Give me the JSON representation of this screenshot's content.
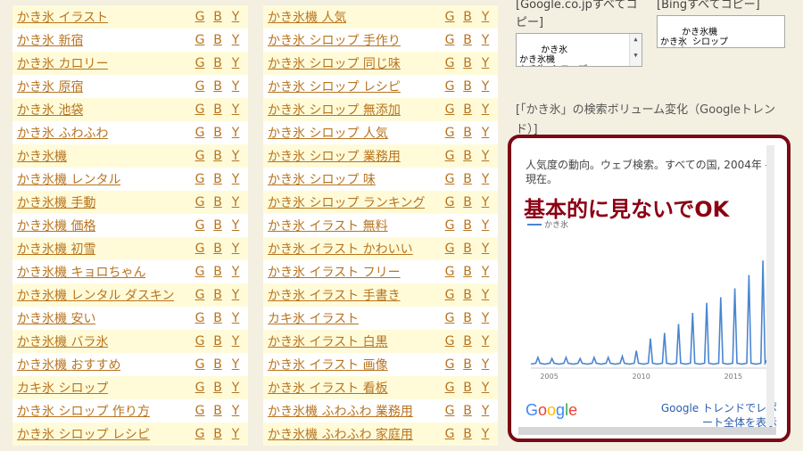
{
  "keywords_col1": [
    "かき氷 イラスト",
    "かき氷 新宿",
    "かき氷 カロリー",
    "かき氷 原宿",
    "かき氷 池袋",
    "かき氷 ふわふわ",
    "かき氷機",
    "かき氷機 レンタル",
    "かき氷機 手動",
    "かき氷機 価格",
    "かき氷機 初雪",
    "かき氷機 キョロちゃん",
    "かき氷機 レンタル ダスキン",
    "かき氷機 安い",
    "かき氷機 バラ氷",
    "かき氷機 おすすめ",
    "カキ氷 シロップ",
    "かき氷 シロップ 作り方",
    "かき氷 シロップ レシピ"
  ],
  "keywords_col2": [
    "かき氷機 人気",
    "かき氷 シロップ 手作り",
    "かき氷 シロップ 同じ味",
    "かき氷 シロップ レシピ",
    "かき氷 シロップ 無添加",
    "かき氷 シロップ 人気",
    "かき氷 シロップ 業務用",
    "かき氷 シロップ 味",
    "かき氷 シロップ ランキング",
    "かき氷 イラスト 無料",
    "かき氷 イラスト かわいい",
    "かき氷 イラスト フリー",
    "かき氷 イラスト 手書き",
    "カキ氷 イラスト",
    "かき氷 イラスト 白黒",
    "かき氷 イラスト 画像",
    "かき氷 イラスト 看板",
    "かき氷機 ふわふわ 業務用",
    "かき氷機 ふわふわ 家庭用"
  ],
  "engine_links": [
    "G",
    "B",
    "Y"
  ],
  "google_copy": {
    "label": "[Google.co.jpすべてコピー]",
    "text": "かき氷\nかき氷機\nかき氷 シロップ"
  },
  "bing_copy": {
    "label": "[Bingすべてコピー]",
    "text": "かき氷機\nかき氷 シロップ\nかき氷 イラスト"
  },
  "trend_section_label": "[「かき氷」の検索ボリューム変化（Googleトレンド）]",
  "trend_widget": {
    "description": "人気度の動向。ウェブ検索。すべての国, 2004年 - 現在。",
    "overlay_text": "基本的に見ないでOK",
    "legend": "かき氷",
    "google_logo": "Google",
    "report_link": "Google トレンドでレポート全体を表示",
    "line_color": "#4a86d0",
    "overlay_color": "#8b0012"
  },
  "chart_data": {
    "type": "line",
    "x": [
      2004,
      2005,
      2006,
      2007,
      2008,
      2009,
      2010,
      2011,
      2012,
      2013,
      2014,
      2015,
      2016,
      2017
    ],
    "xticks": [
      "2005",
      "2010",
      "2015"
    ],
    "series": [
      {
        "name": "かき氷",
        "peaks": [
          8,
          7,
          8,
          7,
          8,
          8,
          9,
          14,
          25,
          30,
          38,
          48,
          57,
          62,
          70,
          82,
          95
        ]
      }
    ],
    "ylim": [
      0,
      100
    ],
    "grid": false
  }
}
